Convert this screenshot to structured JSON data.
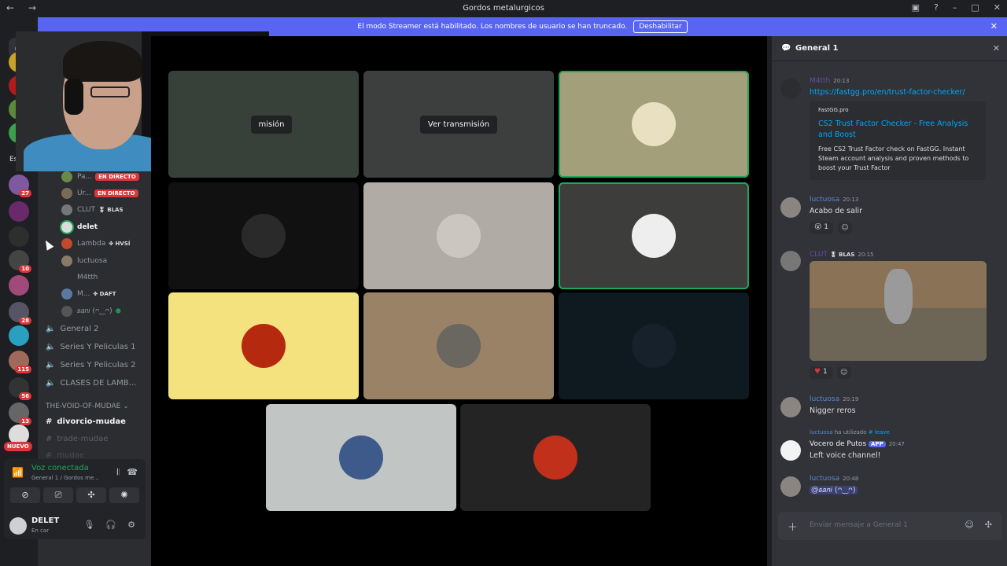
{
  "window": {
    "title": "Gordos metalurgicos",
    "back": "←",
    "forward": "→"
  },
  "banner": {
    "text": "El modo Streamer está habilitado. Los nombres de usuario se han truncado.",
    "button": "Deshabilitar"
  },
  "servers": {
    "badges": [
      "27",
      "10",
      "28",
      "115",
      "56",
      "13"
    ],
    "nuevo": "NUEVO",
    "partial_label": "Es"
  },
  "voice_users": [
    {
      "name": "Pa...",
      "live": "EN DIRECTO"
    },
    {
      "name": "Ur...",
      "live": "EN DIRECTO"
    },
    {
      "name": "CLUT",
      "tag": "🎖 BLAS"
    },
    {
      "name": "delet",
      "bright": true
    },
    {
      "name": "Lambda",
      "tag": "✤ HVSÍ"
    },
    {
      "name": "luctuosa"
    },
    {
      "name": "M4tth"
    },
    {
      "name": "M...",
      "tag": "✤ DAFT"
    },
    {
      "name": "𝑠𝑎𝑛𝑖 (ᴖ‿ᴖ)"
    }
  ],
  "voice_channels": [
    "General 2",
    "Series Y Peliculas 1",
    "Series Y Peliculas 2",
    "CLASES DE LAMB..."
  ],
  "category": "THE-VOID-OF-MUDAE",
  "text_channels": [
    {
      "name": "divorcio-mudae",
      "active": true
    },
    {
      "name": "trade-mudae"
    },
    {
      "name": "mudae"
    }
  ],
  "voice_panel": {
    "status": "Voz conectada",
    "sub": "General 1 / Gordos me..."
  },
  "user_panel": {
    "name": "DELET",
    "status": "En car"
  },
  "stage": {
    "watch_label": "Ver transmisión",
    "watch_label_partial": "misión"
  },
  "chat": {
    "title": "General 1",
    "messages": [
      {
        "author": "M4tth",
        "time": "20:13",
        "text": "https://fastgg.pro/en/trust-factor-checker/"
      },
      {
        "author": "luctuosa",
        "time": "20:13",
        "text": "Acabo de salir",
        "reaction": "1"
      },
      {
        "author": "CLUT",
        "tag": "🎖 BLAS",
        "time": "20:15",
        "reaction": "1"
      },
      {
        "author": "luctuosa",
        "time": "20:19",
        "text": "Nigger reros"
      },
      {
        "author": "Vocero de Putos",
        "app": "APP",
        "time": "20:47",
        "text": "Left voice channel!",
        "system_user": "luctuosa",
        "system_text": "ha utilizado",
        "system_cmd": "# leave"
      },
      {
        "author": "luctuosa",
        "time": "20:48",
        "text": "@𝑠𝑎𝑛𝑖 (ᴖ‿ᴖ)"
      }
    ],
    "embed": {
      "provider": "FastGG.pro",
      "title": "CS2 Trust Factor Checker - Free Analysis and Boost",
      "description": "Free CS2 Trust Factor check on FastGG. Instant Steam account analysis and proven methods to boost your Trust Factor"
    },
    "input_placeholder": "Enviar mensaje a General 1"
  },
  "colors": {
    "accent": "#5865f2",
    "speaking": "#23a55a",
    "live": "#da373c",
    "link": "#00a8fc"
  }
}
